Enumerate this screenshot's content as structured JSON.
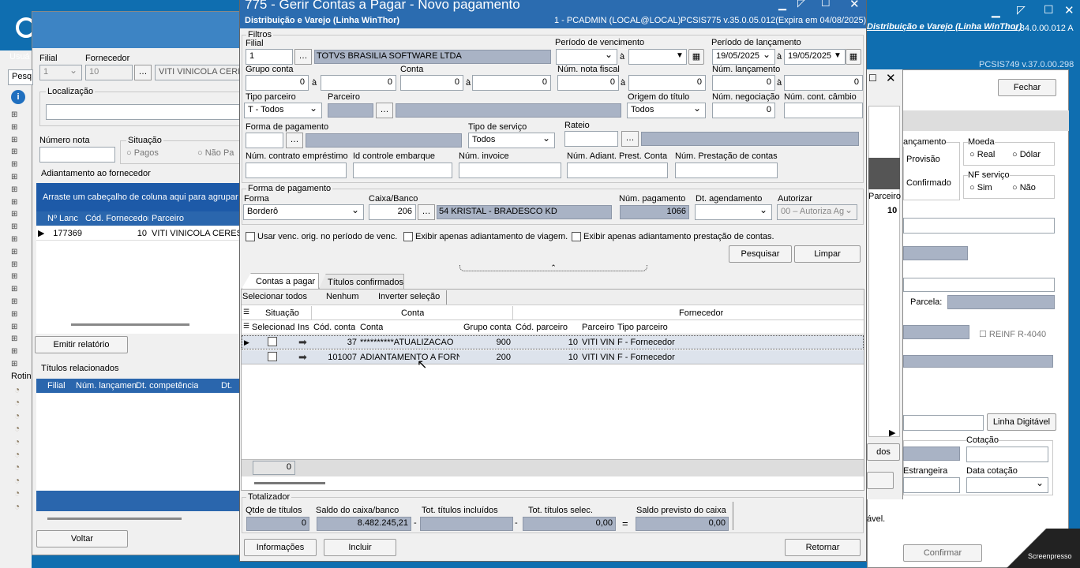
{
  "bg_left": {
    "filial_label": "Filial",
    "fornecedor_label": "Fornecedor",
    "filial_value": "1",
    "fornecedor_value": "10",
    "fornecedor_name": "VITI VINICOLA CERESER S.",
    "localizacao": "Localização",
    "numero_nota": "Número nota",
    "situacao": "Situação",
    "pagos": "Pagos",
    "nao_pagos": "Não Pa",
    "adiantamento": "Adiantamento ao fornecedor",
    "arraste": "Arraste um cabeçalho de coluna aqui para agrupar por",
    "col_nlanc": "Nº Lanc",
    "col_cod": "Cód. Fornecedor",
    "col_parceiro": "Parceiro",
    "row_nlanc": "177369",
    "row_cod": "10",
    "row_parceiro": "VITI VINICOLA CERESER S.",
    "emitir": "Emitir relatório",
    "titulos": "Títulos relacionados",
    "t_filial": "Filial",
    "t_numlanc": "Núm. lançamen",
    "t_dtcomp": "Dt. competência",
    "t_dt": "Dt.",
    "voltar": "Voltar",
    "usua": "Usuá",
    "pesq": "Pesq",
    "rotin": "Rotin"
  },
  "bg_right": {
    "title": "Distribuição e Varejo (Linha WinThor)",
    "version": "v.34.0.00.012 A",
    "pcsis": "PCSIS749 v.37.0.00.298",
    "fechar": "Fechar",
    "lancamento": "ançamento",
    "provisao": "Provisão",
    "confirmado": "Confirmado",
    "moeda": "Moeda",
    "real": "Real",
    "dolar": "Dólar",
    "nf_servico": "NF serviço",
    "sim": "Sim",
    "nao": "Não",
    "parceiro": "Parceiro",
    "parceiro_val": "10",
    "parcela": "Parcela:",
    "reinf": "REINF R-4040",
    "linha_digitavel": "Linha Digitável",
    "cotacao": "Cotação",
    "estrangeira": "Estrangeira",
    "data_cotacao": "Data cotação",
    "dos": "dos",
    "avel": "ável.",
    "confirmar": "Confirmar",
    "screenpresso": "Screenpresso"
  },
  "window": {
    "title": "775 - Gerir Contas a Pagar - Novo pagamento",
    "subtitle": "Distribuição e Varejo (Linha WinThor)",
    "user": "1 - PCADMIN (LOCAL@LOCAL)",
    "version": "PCSIS775 v.35.0.05.012(Expira em 04/08/2025)"
  },
  "filtros": {
    "legend": "Filtros",
    "filial_label": "Filial",
    "filial_value": "1",
    "filial_name": "TOTVS BRASILIA SOFTWARE LTDA",
    "periodo_venc": "Período de vencimento",
    "a1": "à",
    "periodo_lanc": "Período de lançamento",
    "lanc_ini": "19/05/2025",
    "lanc_fim": "19/05/2025",
    "a2": "à",
    "grupo_conta": "Grupo conta",
    "grupo_ini": "0",
    "grupo_fim": "0",
    "conta": "Conta",
    "conta_ini": "0",
    "conta_fim": "0",
    "num_nota": "Núm. nota fiscal",
    "nota_ini": "0",
    "nota_fim": "0",
    "num_lanc": "Núm. lançamento",
    "lanc_num_ini": "0",
    "lanc_num_fim": "0",
    "a": "à",
    "tipo_parceiro": "Tipo parceiro",
    "tipo_parceiro_val": "T - Todos",
    "parceiro": "Parceiro",
    "origem": "Origem do título",
    "origem_val": "Todos",
    "num_negociacao": "Núm. negociação",
    "negociacao_val": "0",
    "num_cambio": "Núm. cont. câmbio",
    "forma_pag": "Forma de pagamento",
    "tipo_servico": "Tipo de serviço",
    "tipo_servico_val": "Todos",
    "rateio": "Rateio",
    "contrato": "Núm. contrato empréstimo",
    "id_embarque": "Id controle embarque",
    "invoice": "Núm. invoice",
    "adiant_prest": "Núm. Adiant. Prest. Conta",
    "prest_contas": "Núm. Prestação de contas"
  },
  "forma": {
    "legend": "Forma de pagamento",
    "forma_label": "Forma",
    "forma_val": "Borderô",
    "caixa_label": "Caixa/Banco",
    "caixa_val": "206",
    "caixa_name": "54 KRISTAL - BRADESCO KD",
    "num_pag_label": "Núm. pagamento",
    "num_pag_val": "1066",
    "dt_agend": "Dt. agendamento",
    "autorizar": "Autorizar",
    "autorizar_val": "00 – Autoriza Ag"
  },
  "opts": {
    "venc_orig": "Usar venc. orig. no período de venc.",
    "adiant_viagem": "Exibir apenas adiantamento de viagem.",
    "adiant_prest": "Exibir apenas adiantamento prestação de contas.",
    "pesquisar": "Pesquisar",
    "limpar": "Limpar"
  },
  "tabs": {
    "contas": "Contas a pagar",
    "titulos": "Títulos confirmados"
  },
  "grid_tools": {
    "todos": "Selecionar todos",
    "nenhum": "Nenhum",
    "inverter": "Inverter seleção"
  },
  "grid": {
    "grp_situacao": "Situação",
    "grp_conta": "Conta",
    "grp_fornecedor": "Fornecedor",
    "cols": [
      "Selecionad",
      "Ins",
      "Cód. conta",
      "Conta",
      "Grupo conta",
      "Cód. parceiro",
      "Parceiro",
      "Tipo parceiro"
    ],
    "rows": [
      {
        "cod": "37",
        "conta": "**********ATUALIZACAO",
        "grupo": "900",
        "codparc": "10",
        "parceiro": "VITI VIN",
        "tipo": "F - Fornecedor"
      },
      {
        "cod": "101007",
        "conta": "ADIANTAMENTO A FORNE",
        "grupo": "200",
        "codparc": "10",
        "parceiro": "VITI VIN",
        "tipo": "F - Fornecedor"
      }
    ],
    "footer_count": "0"
  },
  "totalizador": {
    "legend": "Totalizador",
    "qtde_label": "Qtde de títulos",
    "qtde_val": "0",
    "saldo_label": "Saldo do caixa/banco",
    "saldo_val": "8.482.245,21",
    "incl_label": "Tot. títulos incluídos",
    "incl_val": "",
    "selec_label": "Tot. títulos selec.",
    "selec_val": "0,00",
    "previsto_label": "Saldo previsto do caixa",
    "previsto_val": "0,00",
    "minus1": "-",
    "minus2": "-",
    "eq": "="
  },
  "bottom": {
    "informacoes": "Informações",
    "incluir": "Incluir",
    "retornar": "Retornar"
  }
}
